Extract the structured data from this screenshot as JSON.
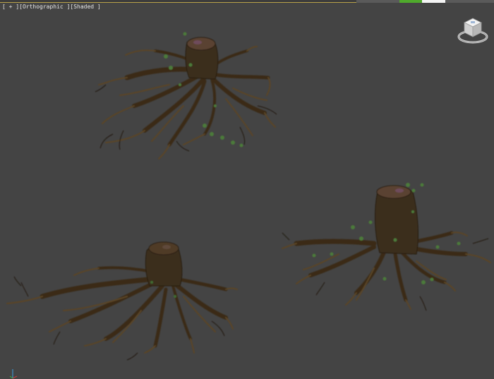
{
  "viewport": {
    "label_open": "[",
    "plus_menu": "+",
    "view_menu": "Orthographic",
    "shading_menu": "Shaded",
    "label_close": "]",
    "separator": "]["
  },
  "colors": {
    "background": "#444444",
    "root_dark": "#2b2114",
    "root_mid": "#4a3a22",
    "root_light": "#6b5636",
    "ivy": "#4c7a3a",
    "status_green": "#4faa2c"
  },
  "icons": {
    "viewcube": "viewcube-icon",
    "axis": "axis-tripod-icon"
  },
  "objects": [
    {
      "name": "tree-stump-top"
    },
    {
      "name": "tree-stump-bottom-left"
    },
    {
      "name": "tree-stump-bottom-right"
    }
  ]
}
